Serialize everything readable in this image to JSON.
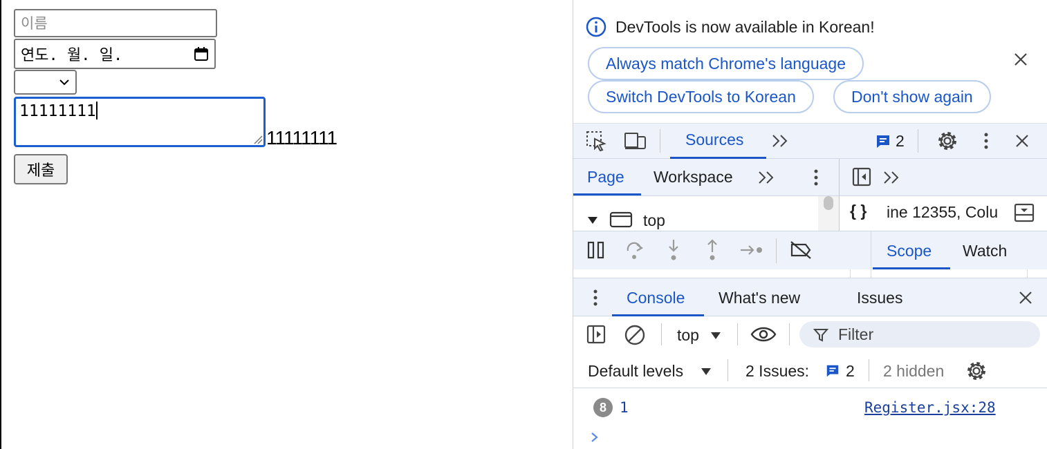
{
  "page": {
    "name_placeholder": "이름",
    "date_value": "연도. 월. 일.",
    "textarea_value": "11111111",
    "echo_text": "11111111",
    "submit_label": "제출"
  },
  "devtools": {
    "banner": {
      "message": "DevTools is now available in Korean!",
      "match_language": "Always match Chrome's language",
      "switch_language": "Switch DevTools to Korean",
      "dont_show": "Don't show again"
    },
    "main_toolbar": {
      "sources_tab": "Sources",
      "message_count": "2"
    },
    "sources": {
      "page_tab": "Page",
      "workspace_tab": "Workspace",
      "tree_top": "top",
      "location_text": "ine 12355, Colu",
      "scope_tab": "Scope",
      "watch_tab": "Watch"
    },
    "drawer": {
      "console_tab": "Console",
      "whats_new_tab": "What's new",
      "issues_tab": "Issues",
      "context": "top",
      "filter_placeholder": "Filter",
      "levels": "Default levels",
      "issues_label": "2 Issues:",
      "issues_count": "2",
      "hidden": "2 hidden"
    },
    "console": {
      "repeat_count": "8",
      "log_value": "1",
      "source_link": "Register.jsx:28"
    }
  },
  "colors": {
    "accent": "#1a56c8",
    "toolbar_bg": "#eef3fb",
    "focus": "#1a5fd0"
  }
}
